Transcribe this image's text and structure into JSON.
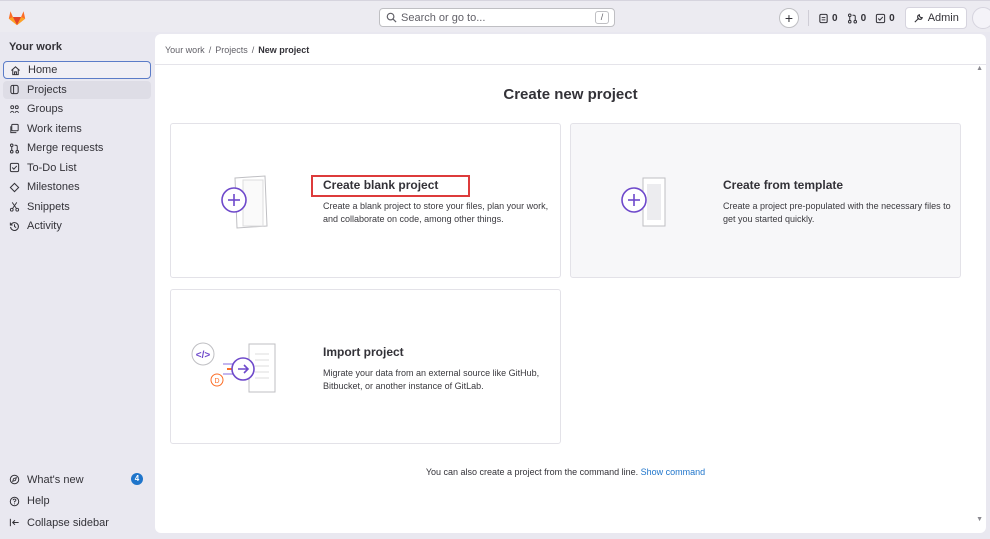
{
  "topbar": {
    "search_placeholder": "Search or go to...",
    "search_shortcut": "/",
    "issues_count": "0",
    "merge_requests_count": "0",
    "todos_count": "0",
    "admin_label": "Admin"
  },
  "sidebar": {
    "title": "Your work",
    "items": [
      {
        "label": "Home",
        "icon": "home-icon"
      },
      {
        "label": "Projects",
        "icon": "project-icon"
      },
      {
        "label": "Groups",
        "icon": "group-icon"
      },
      {
        "label": "Work items",
        "icon": "work-items-icon"
      },
      {
        "label": "Merge requests",
        "icon": "merge-request-icon"
      },
      {
        "label": "To-Do List",
        "icon": "todo-icon"
      },
      {
        "label": "Milestones",
        "icon": "milestone-icon"
      },
      {
        "label": "Snippets",
        "icon": "snippet-icon"
      },
      {
        "label": "Activity",
        "icon": "history-icon"
      }
    ],
    "bottom": [
      {
        "label": "What's new",
        "icon": "whats-new-icon",
        "badge": "4"
      },
      {
        "label": "Help",
        "icon": "help-icon"
      },
      {
        "label": "Collapse sidebar",
        "icon": "collapse-icon"
      }
    ]
  },
  "breadcrumb": {
    "items": [
      "Your work",
      "Projects",
      "New project"
    ],
    "separator": "/"
  },
  "main": {
    "title": "Create new project",
    "cards": [
      {
        "title": "Create blank project",
        "description": "Create a blank project to store your files, plan your work, and collaborate on code, among other things."
      },
      {
        "title": "Create from template",
        "description": "Create a project pre-populated with the necessary files to get you started quickly."
      },
      {
        "title": "Import project",
        "description": "Migrate your data from an external source like GitHub, Bitbucket, or another instance of GitLab."
      }
    ],
    "cli_text": "You can also create a project from the command line.",
    "cli_link": "Show command"
  },
  "colors": {
    "accent": "#1f75cb",
    "highlight": "#dd3b3b",
    "purple": "#6e49cb",
    "logo_orange": "#fc6d26"
  }
}
